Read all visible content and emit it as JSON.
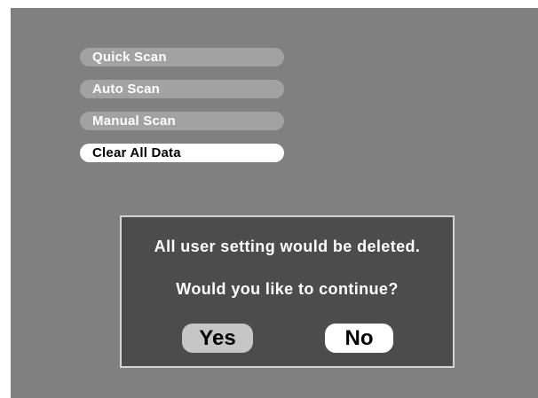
{
  "menu": {
    "items": [
      {
        "label": "Quick Scan",
        "selected": false
      },
      {
        "label": "Auto Scan",
        "selected": false
      },
      {
        "label": "Manual Scan",
        "selected": false
      },
      {
        "label": "Clear All Data",
        "selected": true
      }
    ]
  },
  "dialog": {
    "message_line1": "All user setting would be deleted.",
    "message_line2": "Would you like to continue?",
    "yes_label": "Yes",
    "no_label": "No"
  },
  "colors": {
    "screen_background": "#808080",
    "menu_item_background": "#a2a2a2",
    "menu_item_selected_background": "#ffffff",
    "dialog_background": "#4c4c4c",
    "dialog_border": "#d4d4d4",
    "yes_button": "#c6c6c6",
    "no_button": "#ffffff"
  }
}
